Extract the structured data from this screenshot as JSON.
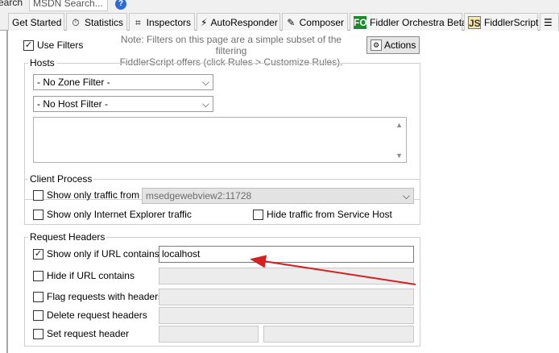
{
  "top_strip": {
    "left_fragment": "earch",
    "tab_fragment": "MSDN Search..."
  },
  "tabs": [
    {
      "label": "Get Started",
      "icon": "none"
    },
    {
      "label": "Statistics",
      "icon": "stopwatch-icon"
    },
    {
      "label": "Inspectors",
      "icon": "inspect-icon"
    },
    {
      "label": "AutoResponder",
      "icon": "lightning-icon"
    },
    {
      "label": "Composer",
      "icon": "pencil-icon"
    },
    {
      "label": "Fiddler Orchestra Beta",
      "icon": "fo-badge-icon",
      "badge": "FO"
    },
    {
      "label": "FiddlerScript",
      "icon": "js-file-icon",
      "badge": "JS"
    }
  ],
  "filters": {
    "use_filters_label": "Use Filters",
    "use_filters_checked": true,
    "note_line1": "Note: Filters on this page are a simple subset of the filtering",
    "note_line2": "FiddlerScript offers (click Rules > Customize Rules).",
    "actions_label": "Actions"
  },
  "hosts": {
    "title": "Hosts",
    "zone_filter": "- No Zone Filter -",
    "host_filter": "- No Host Filter -"
  },
  "client_process": {
    "title": "Client Process",
    "show_only_traffic_from_label": "Show only traffic from",
    "process_value": "msedgewebview2:11728",
    "show_only_ie_label": "Show only Internet Explorer traffic",
    "hide_service_host_label": "Hide traffic from Service Host"
  },
  "request_headers": {
    "title": "Request Headers",
    "show_only_url_label": "Show only if URL contains",
    "show_only_url_checked": true,
    "show_only_url_value": "localhost",
    "hide_url_label": "Hide if URL contains",
    "flag_headers_label": "Flag requests with headers",
    "delete_headers_label": "Delete request headers",
    "set_header_label": "Set request header"
  },
  "colors": {
    "annotation_arrow": "#d42020",
    "fo_badge": "#1a8a2a",
    "help_icon": "#2f6bd5"
  }
}
